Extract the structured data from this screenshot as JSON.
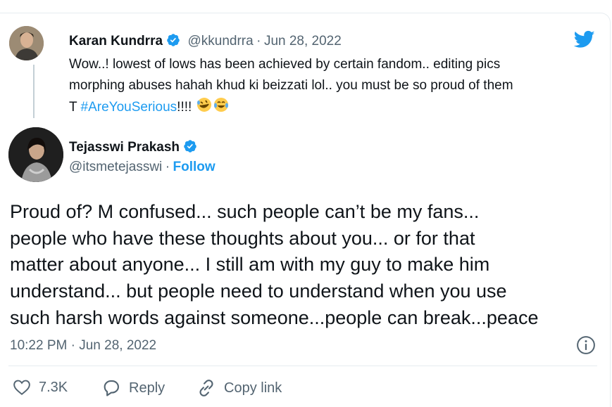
{
  "quoted_tweet": {
    "author_name": "Karan Kundrra",
    "handle": "@kkundrra",
    "separator": "·",
    "date": "Jun 28, 2022",
    "text_line1": "Wow..! lowest of lows has been achieved by certain fandom.. editing pics",
    "text_line2": "morphing abuses hahah khud ki beizzati lol.. you must be so proud of them",
    "text_line3_prefix": "T ",
    "hashtag": "#AreYouSerious",
    "text_line3_suffix": "!!!!",
    "emojis": [
      "rolling-on-floor-laughing-emoji",
      "tears-of-joy-emoji"
    ]
  },
  "main_tweet": {
    "author_name": "Tejasswi Prakash",
    "handle": "@itsmetejasswi",
    "separator": "·",
    "follow_label": "Follow",
    "text_lines": [
      "Proud of? M confused... such people can’t be my fans...",
      "people who have these thoughts about you... or for that",
      "matter about anyone... I still am with my guy to make him",
      "understand... but people need to understand when you use",
      "such harsh words against someone...people can break...peace"
    ],
    "timestamp": "10:22 PM · Jun 28, 2022"
  },
  "actions": {
    "like_count": "7.3K",
    "reply_label": "Reply",
    "copy_link_label": "Copy link"
  },
  "icons": {
    "brand": "twitter-bird-icon",
    "verified": "verified-badge-icon",
    "info": "info-icon",
    "like": "heart-icon",
    "reply": "reply-bubble-icon",
    "copy": "link-icon"
  },
  "colors": {
    "accent": "#1d9bf0",
    "text": "#0f1419",
    "muted": "#536471"
  }
}
